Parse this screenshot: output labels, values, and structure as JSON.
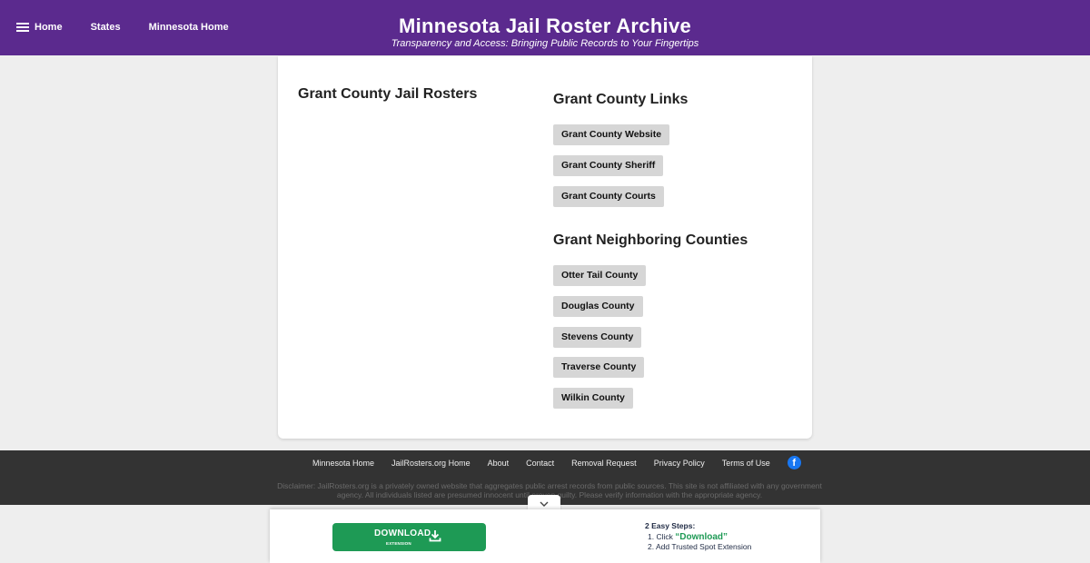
{
  "nav": {
    "home_label": "Home",
    "states_label": "States",
    "minnesota_home_label": "Minnesota Home"
  },
  "header": {
    "title": "Minnesota Jail Roster Archive",
    "tagline": "Transparency and Access: Bringing Public Records to Your Fingertips"
  },
  "main": {
    "rosters_title": "Grant County Jail Rosters",
    "links_title": "Grant County Links",
    "links": [
      {
        "label": "Grant County Website"
      },
      {
        "label": "Grant County Sheriff"
      },
      {
        "label": "Grant County Courts"
      }
    ],
    "neighbors_title": "Grant Neighboring Counties",
    "neighbors": [
      {
        "label": "Otter Tail County"
      },
      {
        "label": "Douglas County"
      },
      {
        "label": "Stevens County"
      },
      {
        "label": "Traverse County"
      },
      {
        "label": "Wilkin County"
      }
    ]
  },
  "footer": {
    "links": [
      {
        "label": "Minnesota Home"
      },
      {
        "label": "JailRosters.org Home"
      },
      {
        "label": "About"
      },
      {
        "label": "Contact"
      },
      {
        "label": "Removal Request"
      },
      {
        "label": "Privacy Policy"
      },
      {
        "label": "Terms of Use"
      }
    ],
    "facebook_icon": "facebook-icon",
    "disclaimer": "Disclaimer: JailRosters.org is a privately owned website that aggregates public arrest records from public sources. This site is not affiliated with any government agency. All individuals listed are presumed innocent until proven guilty. Please verify information with the appropriate agency."
  },
  "banner": {
    "download_label": "DOWNLOAD",
    "download_sub": "EXTENSION",
    "steps_title": "2 Easy Steps:",
    "step1_prefix": "Click ",
    "step1_quote": "“Download”",
    "step2": "Add Trusted Spot Extension"
  },
  "colors": {
    "header_bg": "#5b2a8e",
    "footer_bg": "#333333",
    "download_green": "#1e9a55"
  }
}
